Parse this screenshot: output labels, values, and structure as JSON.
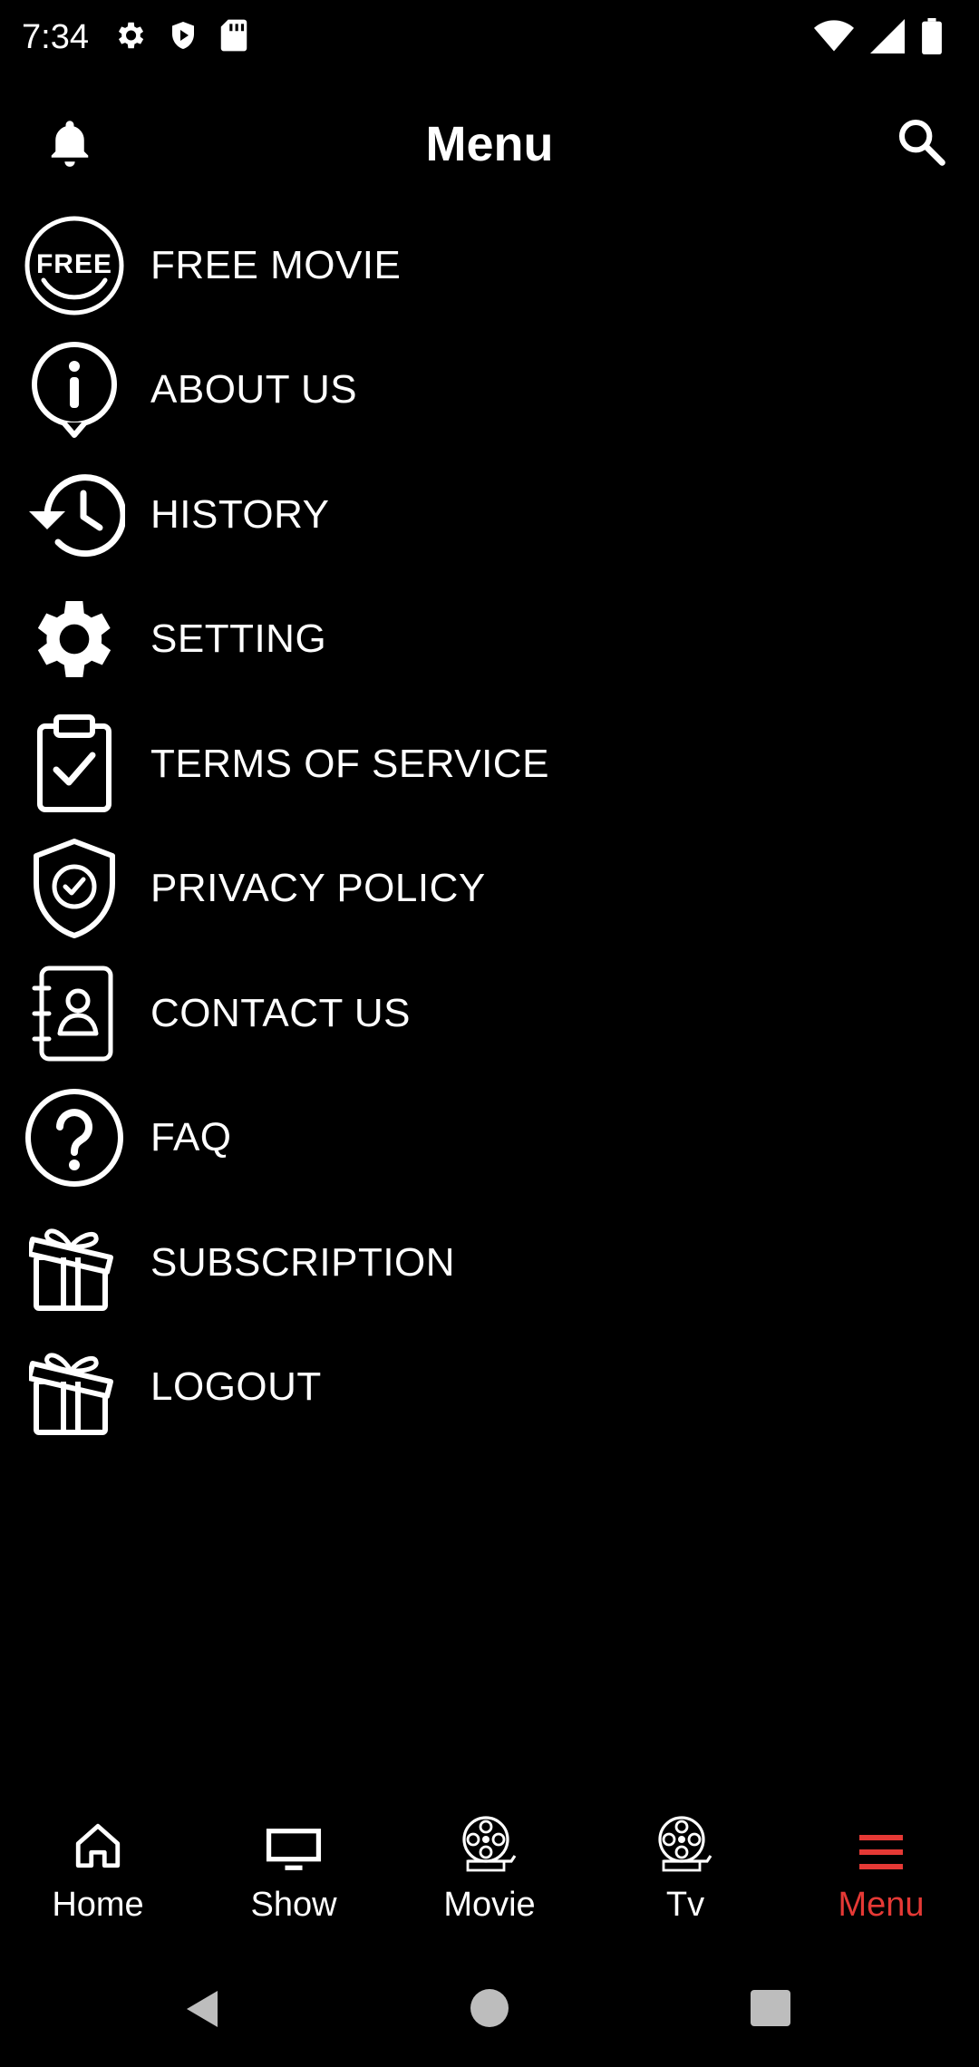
{
  "status_bar": {
    "time": "7:34",
    "left_icons": [
      "gear-icon",
      "shield-icon",
      "sd-card-icon"
    ],
    "right_icons": [
      "wifi-icon",
      "signal-icon",
      "battery-icon"
    ]
  },
  "header": {
    "title": "Menu",
    "left_icon": "bell-icon",
    "right_icon": "search-icon"
  },
  "menu": {
    "items": [
      {
        "label": "FREE MOVIE",
        "icon": "free-badge-icon",
        "badge_text": "FREE"
      },
      {
        "label": "ABOUT US",
        "icon": "info-bubble-icon"
      },
      {
        "label": "HISTORY",
        "icon": "history-icon"
      },
      {
        "label": "SETTING",
        "icon": "gear-icon"
      },
      {
        "label": "TERMS OF SERVICE",
        "icon": "clipboard-check-icon"
      },
      {
        "label": "PRIVACY POLICY",
        "icon": "shield-check-icon"
      },
      {
        "label": "CONTACT US",
        "icon": "contact-book-icon"
      },
      {
        "label": "FAQ",
        "icon": "question-circle-icon"
      },
      {
        "label": "SUBSCRIPTION",
        "icon": "gift-icon"
      },
      {
        "label": "LOGOUT",
        "icon": "gift-icon"
      }
    ]
  },
  "bottom_nav": {
    "items": [
      {
        "label": "Home",
        "icon": "home-icon",
        "active": false
      },
      {
        "label": "Show",
        "icon": "tv-monitor-icon",
        "active": false
      },
      {
        "label": "Movie",
        "icon": "film-reel-icon",
        "active": false
      },
      {
        "label": "Tv",
        "icon": "film-reel-icon",
        "active": false
      },
      {
        "label": "Menu",
        "icon": "hamburger-menu-icon",
        "active": true
      }
    ]
  },
  "system_nav": {
    "buttons": [
      "back-icon",
      "home-circle-icon",
      "recents-icon"
    ]
  },
  "colors": {
    "background": "#000000",
    "foreground": "#ffffff",
    "accent": "#e53935",
    "system_nav": "#bdbdbd"
  }
}
